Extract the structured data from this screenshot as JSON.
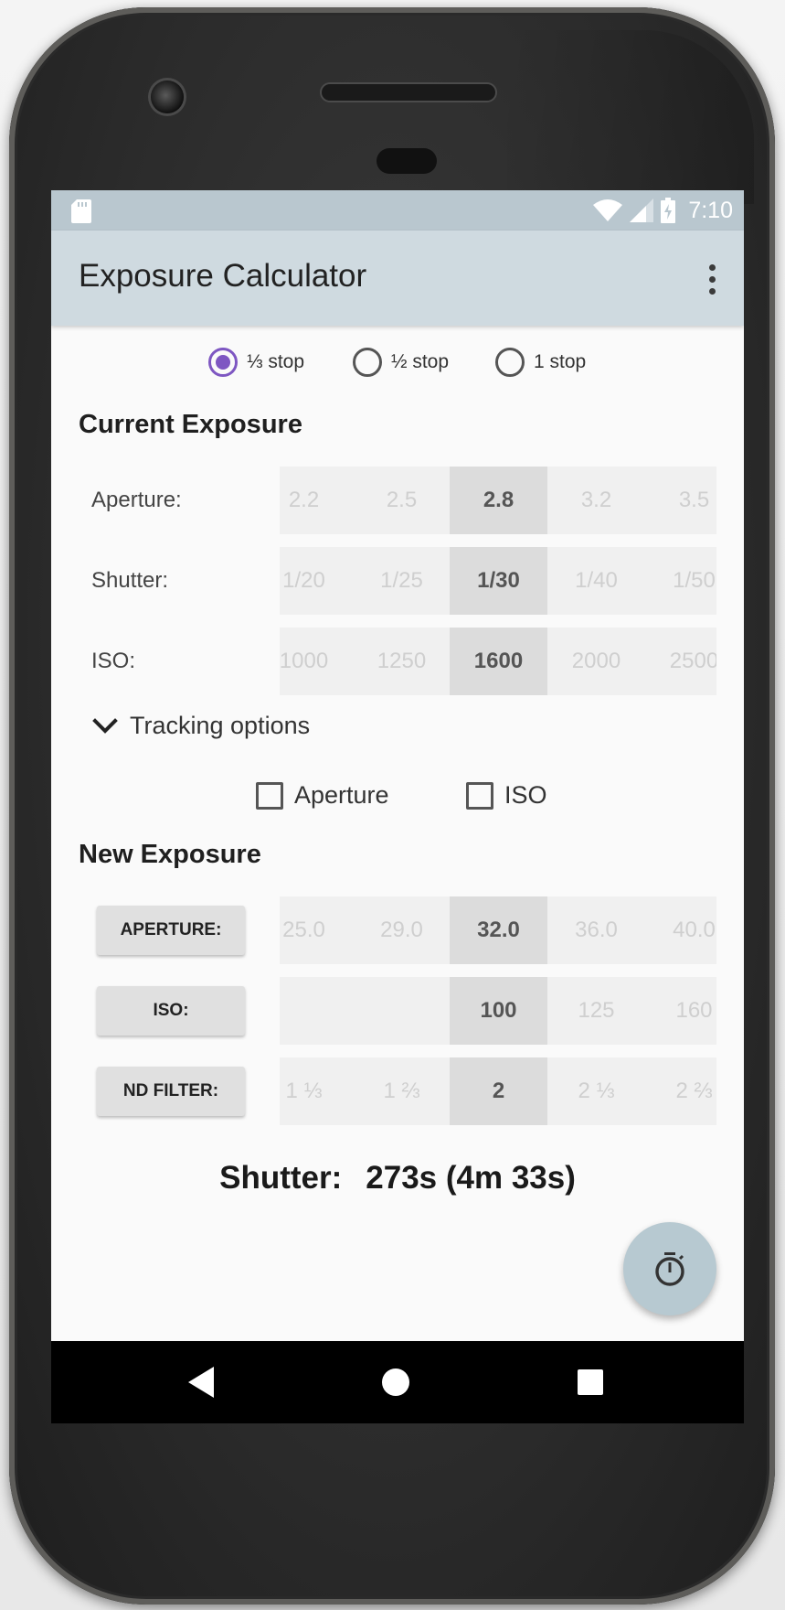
{
  "status_bar": {
    "time": "7:10",
    "icons": [
      "sd-card-icon",
      "wifi-icon",
      "signal-icon",
      "battery-charging-icon"
    ]
  },
  "app_bar": {
    "title": "Exposure Calculator",
    "actions": [
      "moon-icon",
      "more-vert-icon"
    ]
  },
  "stop_options": [
    {
      "label": "⅓ stop",
      "checked": true
    },
    {
      "label": "½ stop",
      "checked": false
    },
    {
      "label": "1 stop",
      "checked": false
    }
  ],
  "current_exposure": {
    "title": "Current Exposure",
    "rows": [
      {
        "label": "Aperture:",
        "values": [
          "2.2",
          "2.5",
          "2.8",
          "3.2",
          "3.5"
        ],
        "selected": "2.8"
      },
      {
        "label": "Shutter:",
        "values": [
          "1/20",
          "1/25",
          "1/30",
          "1/40",
          "1/50"
        ],
        "selected": "1/30"
      },
      {
        "label": "ISO:",
        "values": [
          "1000",
          "1250",
          "1600",
          "2000",
          "2500"
        ],
        "selected": "1600"
      }
    ]
  },
  "tracking": {
    "label": "Tracking options",
    "options": [
      {
        "label": "Aperture",
        "checked": false
      },
      {
        "label": "ISO",
        "checked": false
      }
    ]
  },
  "new_exposure": {
    "title": "New Exposure",
    "rows": [
      {
        "button": "APERTURE:",
        "values": [
          "25.0",
          "29.0",
          "32.0",
          "36.0",
          "40.0"
        ],
        "selected": "32.0"
      },
      {
        "button": "ISO:",
        "values": [
          "",
          "",
          "100",
          "125",
          "160"
        ],
        "selected": "100"
      },
      {
        "button": "ND FILTER:",
        "values": [
          "1 ⅓",
          "1 ⅔",
          "2",
          "2 ⅓",
          "2 ⅔"
        ],
        "selected": "2"
      }
    ]
  },
  "result": {
    "label": "Shutter:",
    "value": "273s (4m 33s)"
  },
  "fab": {
    "icon": "timer-icon"
  },
  "nav_bar": {
    "icons": [
      "back-icon",
      "home-icon",
      "recents-icon"
    ]
  },
  "colors": {
    "accent": "#7e57c2",
    "app_bar": "#cfdae0",
    "status_bar": "#b9c7cf",
    "fab": "#b7c9d1"
  }
}
